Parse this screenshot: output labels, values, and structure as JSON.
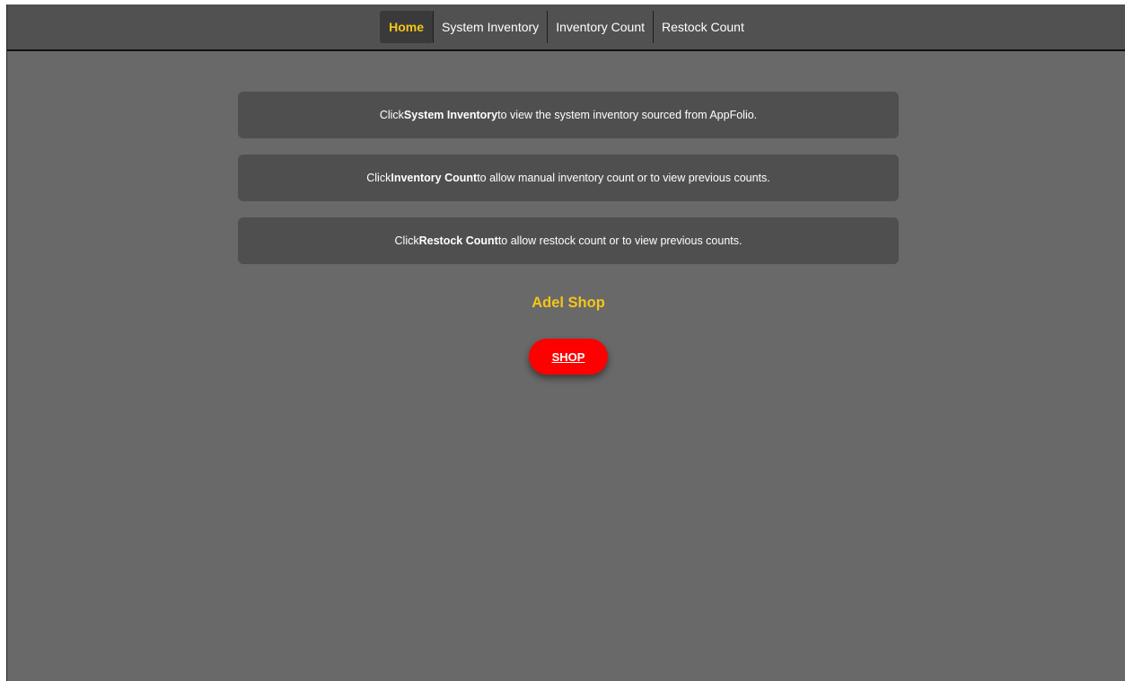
{
  "nav": {
    "items": [
      {
        "label": "Home",
        "active": true
      },
      {
        "label": "System Inventory",
        "active": false
      },
      {
        "label": "Inventory Count",
        "active": false
      },
      {
        "label": "Restock Count",
        "active": false
      }
    ]
  },
  "info": {
    "boxes": [
      {
        "prefix": "Click ",
        "bold": "System Inventory",
        "suffix": " to view the system inventory sourced from AppFolio."
      },
      {
        "prefix": "Click ",
        "bold": "Inventory Count",
        "suffix": " to allow manual inventory count or to view previous counts."
      },
      {
        "prefix": "Click ",
        "bold": "Restock Count",
        "suffix": " to allow restock count or to view previous counts."
      }
    ]
  },
  "shop": {
    "title": "Adel Shop",
    "button_label": "SHOP"
  },
  "colors": {
    "accent": "#f5c518",
    "shop_button": "#ff0000",
    "background": "#696969",
    "navbar": "#515151",
    "box": "#4f4f4f"
  }
}
